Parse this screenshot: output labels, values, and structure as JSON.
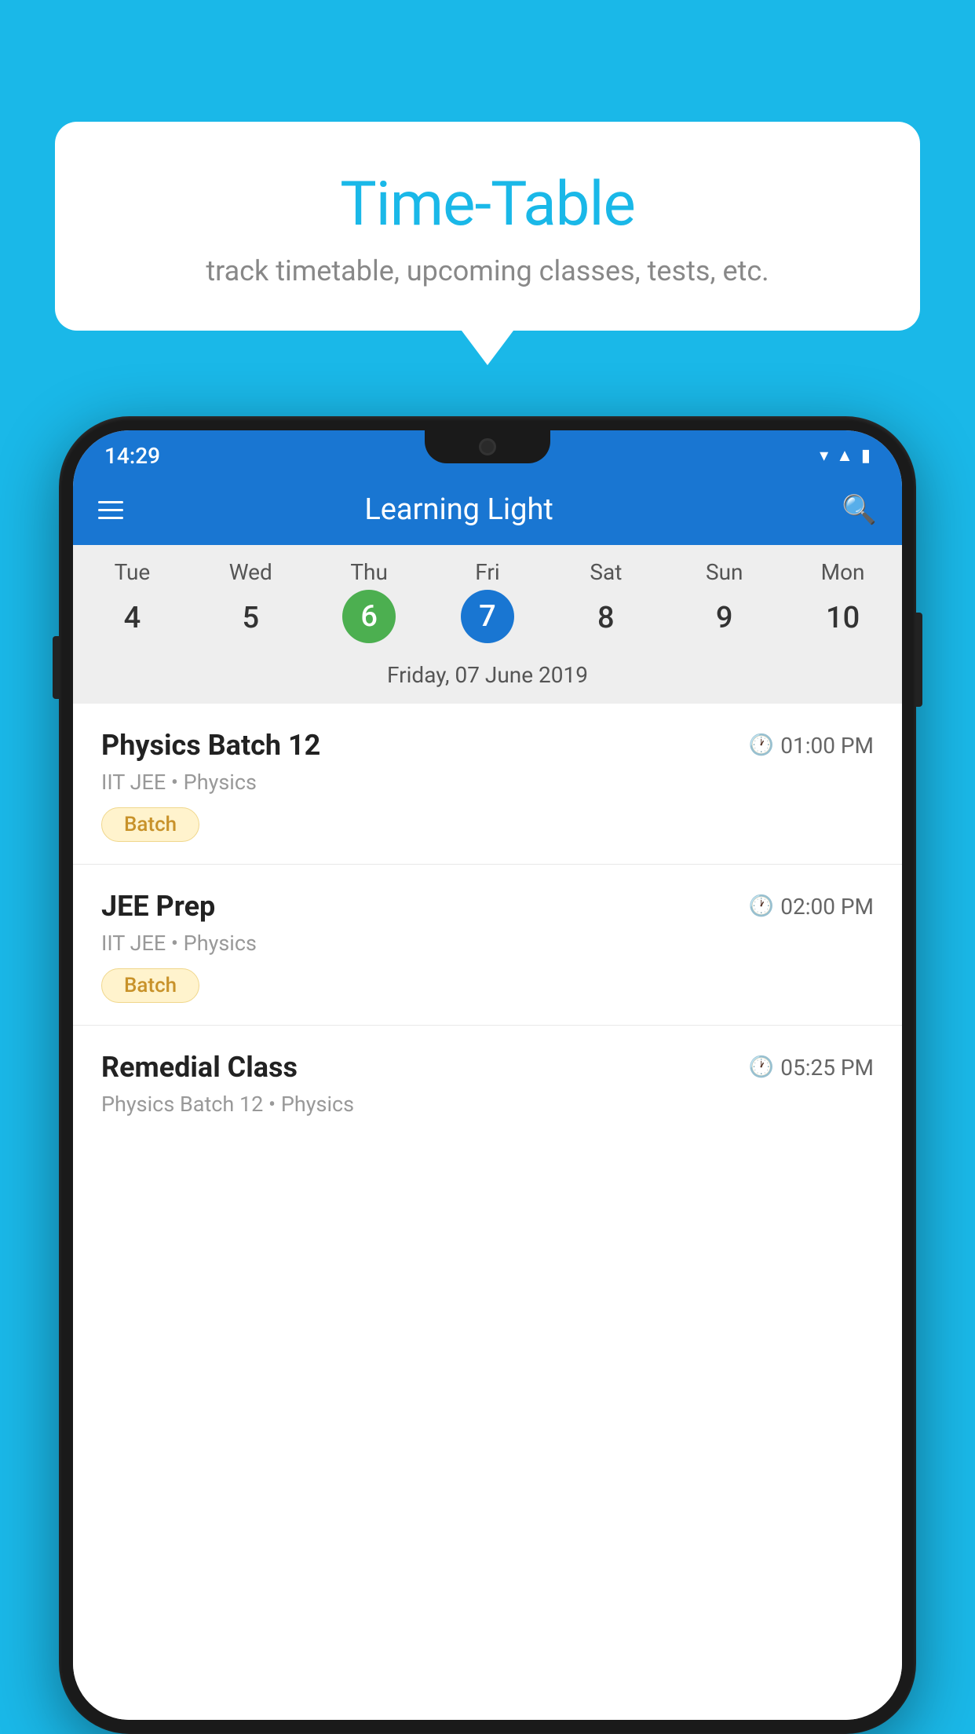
{
  "background_color": "#1ab8e8",
  "speech_bubble": {
    "title": "Time-Table",
    "subtitle": "track timetable, upcoming classes, tests, etc."
  },
  "status_bar": {
    "time": "14:29"
  },
  "top_bar": {
    "app_title": "Learning Light",
    "hamburger_label": "menu",
    "search_label": "search"
  },
  "calendar": {
    "days": [
      {
        "label": "Tue",
        "number": "4"
      },
      {
        "label": "Wed",
        "number": "5"
      },
      {
        "label": "Thu",
        "number": "6",
        "state": "today"
      },
      {
        "label": "Fri",
        "number": "7",
        "state": "selected"
      },
      {
        "label": "Sat",
        "number": "8"
      },
      {
        "label": "Sun",
        "number": "9"
      },
      {
        "label": "Mon",
        "number": "10"
      }
    ],
    "selected_date": "Friday, 07 June 2019"
  },
  "classes": [
    {
      "name": "Physics Batch 12",
      "time": "01:00 PM",
      "meta": "IIT JEE • Physics",
      "badge": "Batch"
    },
    {
      "name": "JEE Prep",
      "time": "02:00 PM",
      "meta": "IIT JEE • Physics",
      "badge": "Batch"
    },
    {
      "name": "Remedial Class",
      "time": "05:25 PM",
      "meta": "Physics Batch 12 • Physics",
      "badge": null
    }
  ]
}
